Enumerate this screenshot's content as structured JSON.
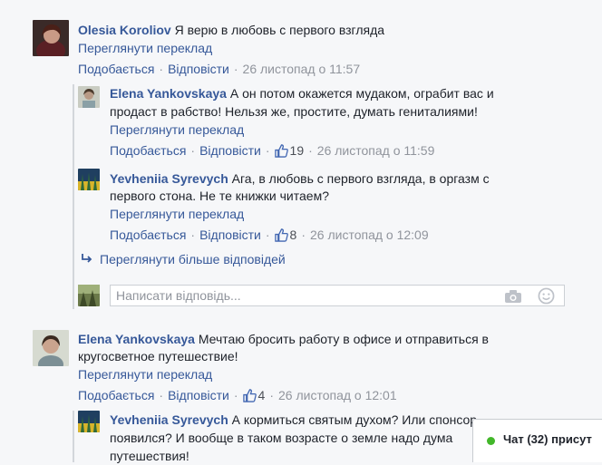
{
  "comments": [
    {
      "author": "Olesia Koroliov",
      "text": "Я верю в любовь с первого взгляда",
      "translate": "Переглянути переклад",
      "like": "Подобається",
      "reply": "Відповісти",
      "time": "26 листопад о 11:57",
      "replies": [
        {
          "author": "Elena Yankovskaya",
          "text_line1": "А он потом окажется мудаком, ограбит вас и",
          "text_line2": "продаст в рабство! Нельзя же, простите, думать гениталиями!",
          "translate": "Переглянути переклад",
          "like": "Подобається",
          "reply": "Відповісти",
          "likes": "19",
          "time": "26 листопад о 11:59"
        },
        {
          "author": "Yevheniia Syrevych",
          "text_line1": "Ага, в любовь с первого взгляда, в оргазм с",
          "text_line2": "первого стона. Не те книжки читаем?",
          "translate": "Переглянути переклад",
          "like": "Подобається",
          "reply": "Відповісти",
          "likes": "8",
          "time": "26 листопад о 12:09"
        }
      ],
      "more_replies": "Переглянути більше відповідей",
      "reply_placeholder": "Написати відповідь..."
    },
    {
      "author": "Elena Yankovskaya",
      "text_line1": "Мечтаю бросить работу в офисе и отправиться в",
      "text_line2": "кругосветное путешествие!",
      "translate": "Переглянути переклад",
      "like": "Подобається",
      "reply": "Відповісти",
      "likes": "4",
      "time": "26 листопад о 12:01",
      "replies": [
        {
          "author": "Yevheniia Syrevych",
          "text_line1": "А кормиться святым духом? Или спонсор",
          "text_line2": "появился? И вообще в таком возрасте о земле надо дума",
          "text_line3": "путешествия!"
        }
      ]
    }
  ],
  "chat": {
    "label": "Чат (32) присут"
  },
  "colors": {
    "link": "#365899",
    "meta": "#90949c",
    "online": "#42b72a"
  }
}
